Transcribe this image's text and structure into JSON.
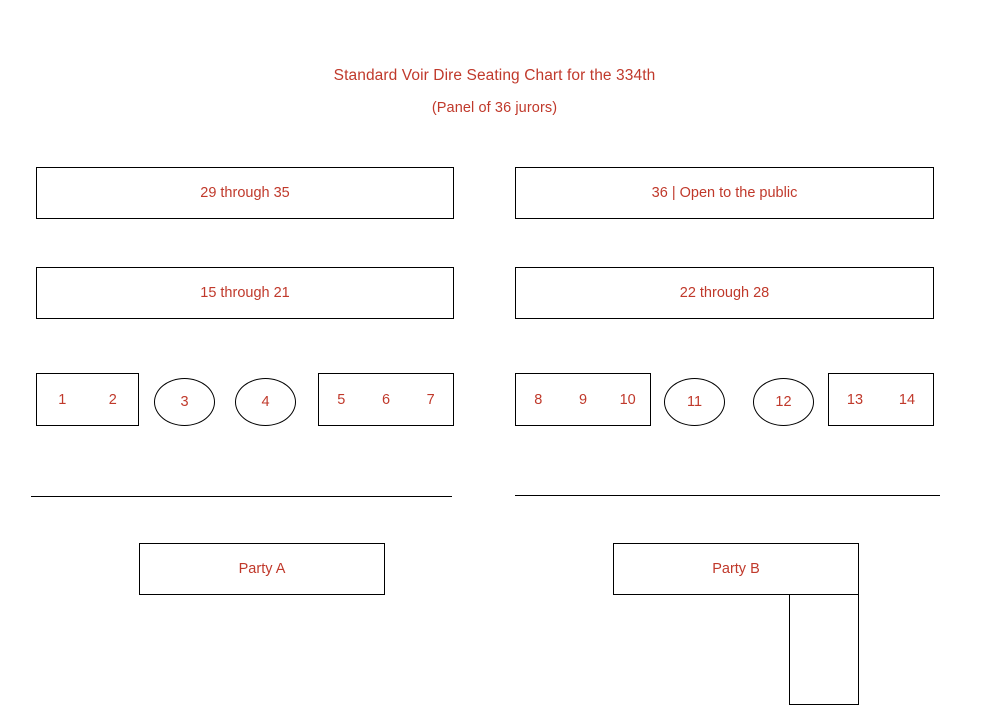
{
  "header": {
    "title": "Standard Voir Dire Seating Chart for the 334th",
    "subtitle": "(Panel of 36 jurors)"
  },
  "colors": {
    "text_red": "#c0392b",
    "outline_black": "#000000",
    "background": "#ffffff"
  },
  "gallery": {
    "back_row": [
      {
        "id": "back-left",
        "label": "29 through 35"
      },
      {
        "id": "back-right",
        "label": "36 | Open to the public"
      }
    ],
    "middle_row": [
      {
        "id": "middle-left",
        "label": "15 through 21"
      },
      {
        "id": "middle-right",
        "label": "22 through 28"
      }
    ]
  },
  "front_row": {
    "left_group": {
      "box_a": {
        "seats": [
          "1",
          "2"
        ]
      },
      "ellipse_a": {
        "seat": "3"
      },
      "ellipse_b": {
        "seat": "4"
      },
      "box_b": {
        "seats": [
          "5",
          "6",
          "7"
        ]
      }
    },
    "right_group": {
      "box_a": {
        "seats": [
          "8",
          "9",
          "10"
        ]
      },
      "ellipse_a": {
        "seat": "11"
      },
      "ellipse_b": {
        "seat": "12"
      },
      "box_b": {
        "seats": [
          "13",
          "14"
        ]
      }
    }
  },
  "parties": [
    {
      "id": "party-a",
      "label": "Party A"
    },
    {
      "id": "party-b",
      "label": "Party B"
    }
  ],
  "annex": {
    "label": ""
  }
}
